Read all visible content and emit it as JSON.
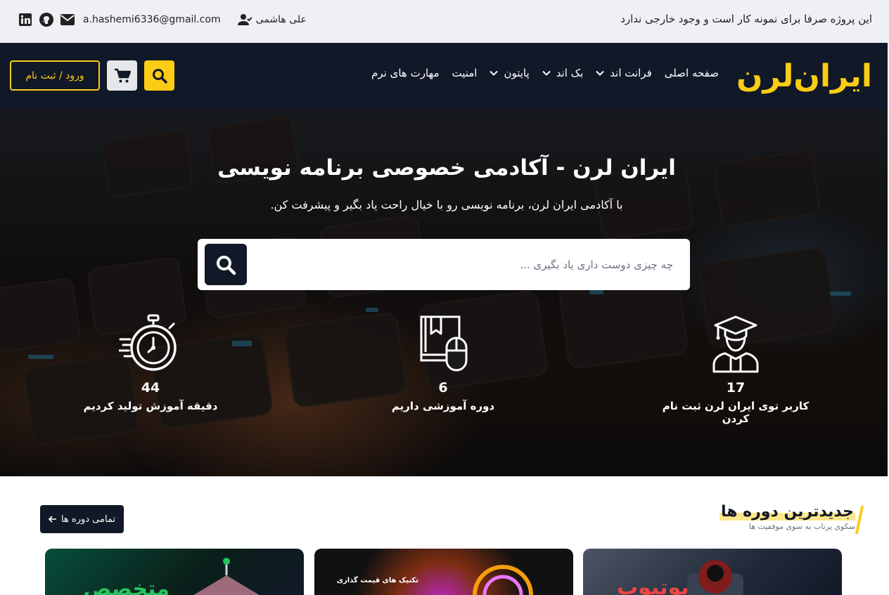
{
  "topbar": {
    "notice": "این پروژه صرفا برای نمونه کار است و وجود خارجی ندارد",
    "user_name": "علی هاشمی",
    "email": "a.hashemi6336@gmail.com",
    "icons": [
      "user-icon",
      "mail-icon",
      "github-icon",
      "linkedin-icon"
    ]
  },
  "nav": {
    "logo_text": "ایران‌لرن",
    "brand_color": "#facc15",
    "background": "#111827",
    "menu": [
      {
        "label": "صفحه اصلی",
        "dropdown": false
      },
      {
        "label": "فرانت اند",
        "dropdown": true
      },
      {
        "label": "بک اند",
        "dropdown": true
      },
      {
        "label": "پایتون",
        "dropdown": true
      },
      {
        "label": "امنیت",
        "dropdown": false
      },
      {
        "label": "مهارت های نرم",
        "dropdown": false
      }
    ],
    "login_label": "ورود / ثبت نام"
  },
  "hero": {
    "title": "ایران لرن - آکادمی خصوصی برنامه نویسی",
    "subtitle": "با آکادمی ایران لرن، برنامه نویسی رو با خیال راحت یاد بگیر و پیشرفت کن.",
    "search_placeholder": "چه چیزی دوست داری یاد بگیری ...",
    "stats": [
      {
        "number": "17",
        "label": "کاربر توی ایران لرن ثبت نام کردن",
        "icon": "graduate-icon"
      },
      {
        "number": "6",
        "label": "دوره آموزشی داریم",
        "icon": "book-mouse-icon"
      },
      {
        "number": "44",
        "label": "دقیقه آموزش تولید کردیم",
        "icon": "stopwatch-icon"
      }
    ]
  },
  "latest": {
    "title": "جدیدترین دوره ها",
    "subtitle": "سکوی پرتاب به سوی موفقیت ها",
    "all_button": "تمامی دوره ها"
  },
  "cards": [
    {
      "text": "یوتیوب",
      "color": "#ef4444"
    },
    {
      "text": "تکنیک های قیمت گذاری",
      "color": "#ffffff"
    },
    {
      "text": "متخصص",
      "color": "#22c55e"
    }
  ]
}
